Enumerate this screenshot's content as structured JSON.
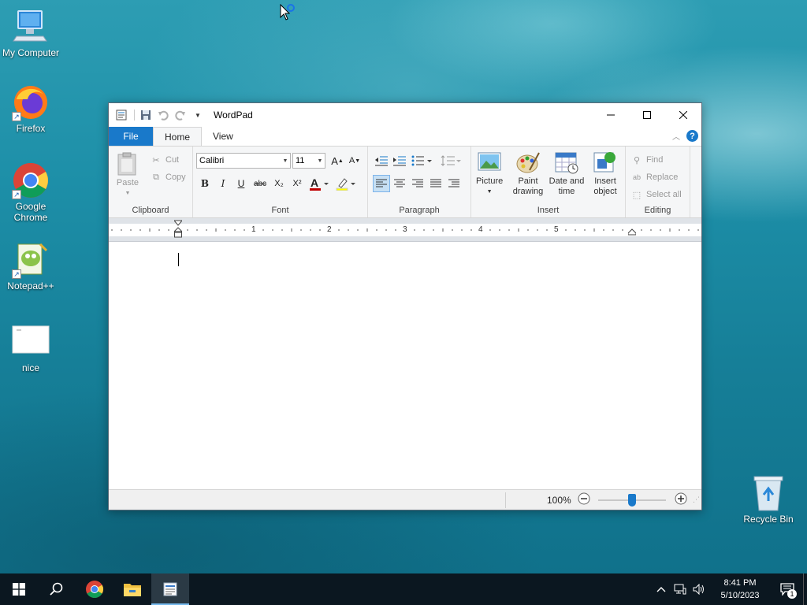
{
  "desktop": {
    "icons": [
      {
        "label": "My Computer"
      },
      {
        "label": "Firefox"
      },
      {
        "label": "Google Chrome"
      },
      {
        "label": "Notepad++"
      },
      {
        "label": "nice"
      },
      {
        "label": "Recycle Bin"
      }
    ]
  },
  "window": {
    "title": "WordPad",
    "tabs": {
      "file": "File",
      "home": "Home",
      "view": "View"
    },
    "help": "?",
    "ribbon": {
      "clipboard": {
        "label": "Clipboard",
        "paste": "Paste",
        "cut": "Cut",
        "copy": "Copy"
      },
      "font": {
        "label": "Font",
        "family": "Calibri",
        "size": "11",
        "bold": "B",
        "italic": "I",
        "underline": "U",
        "strikethrough": "abc",
        "subscript": "X₂",
        "superscript": "X²"
      },
      "paragraph": {
        "label": "Paragraph"
      },
      "insert": {
        "label": "Insert",
        "picture": "Picture",
        "paint_drawing": "Paint drawing",
        "date_time": "Date and time",
        "insert_object": "Insert object"
      },
      "editing": {
        "label": "Editing",
        "find": "Find",
        "replace": "Replace",
        "select_all": "Select all"
      }
    },
    "ruler": {
      "numbers": [
        "1",
        "2",
        "3",
        "4",
        "5"
      ]
    },
    "status": {
      "zoom": "100%"
    }
  },
  "taskbar": {
    "time": "8:41 PM",
    "date": "5/10/2023",
    "notifications": "1"
  },
  "colors": {
    "accent": "#1979ca",
    "taskbar": "#0b1720"
  }
}
